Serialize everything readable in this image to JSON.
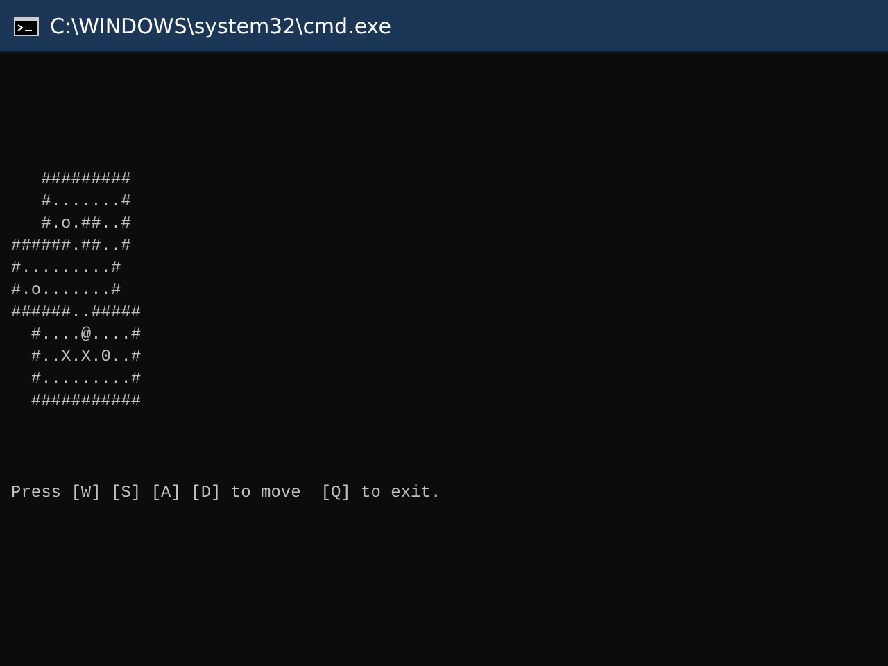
{
  "window": {
    "title": "C:\\WINDOWS\\system32\\cmd.exe"
  },
  "console": {
    "map_lines": [
      "   #########",
      "   #.......#",
      "   #.o.##..#",
      "######.##..#",
      "#.........#",
      "#.o.......#",
      "######..#####",
      "  #....@....#",
      "  #..X.X.0..#",
      "  #.........#",
      "  ###########"
    ],
    "prompt": "Press [W] [S] [A] [D] to move  [Q] to exit."
  }
}
